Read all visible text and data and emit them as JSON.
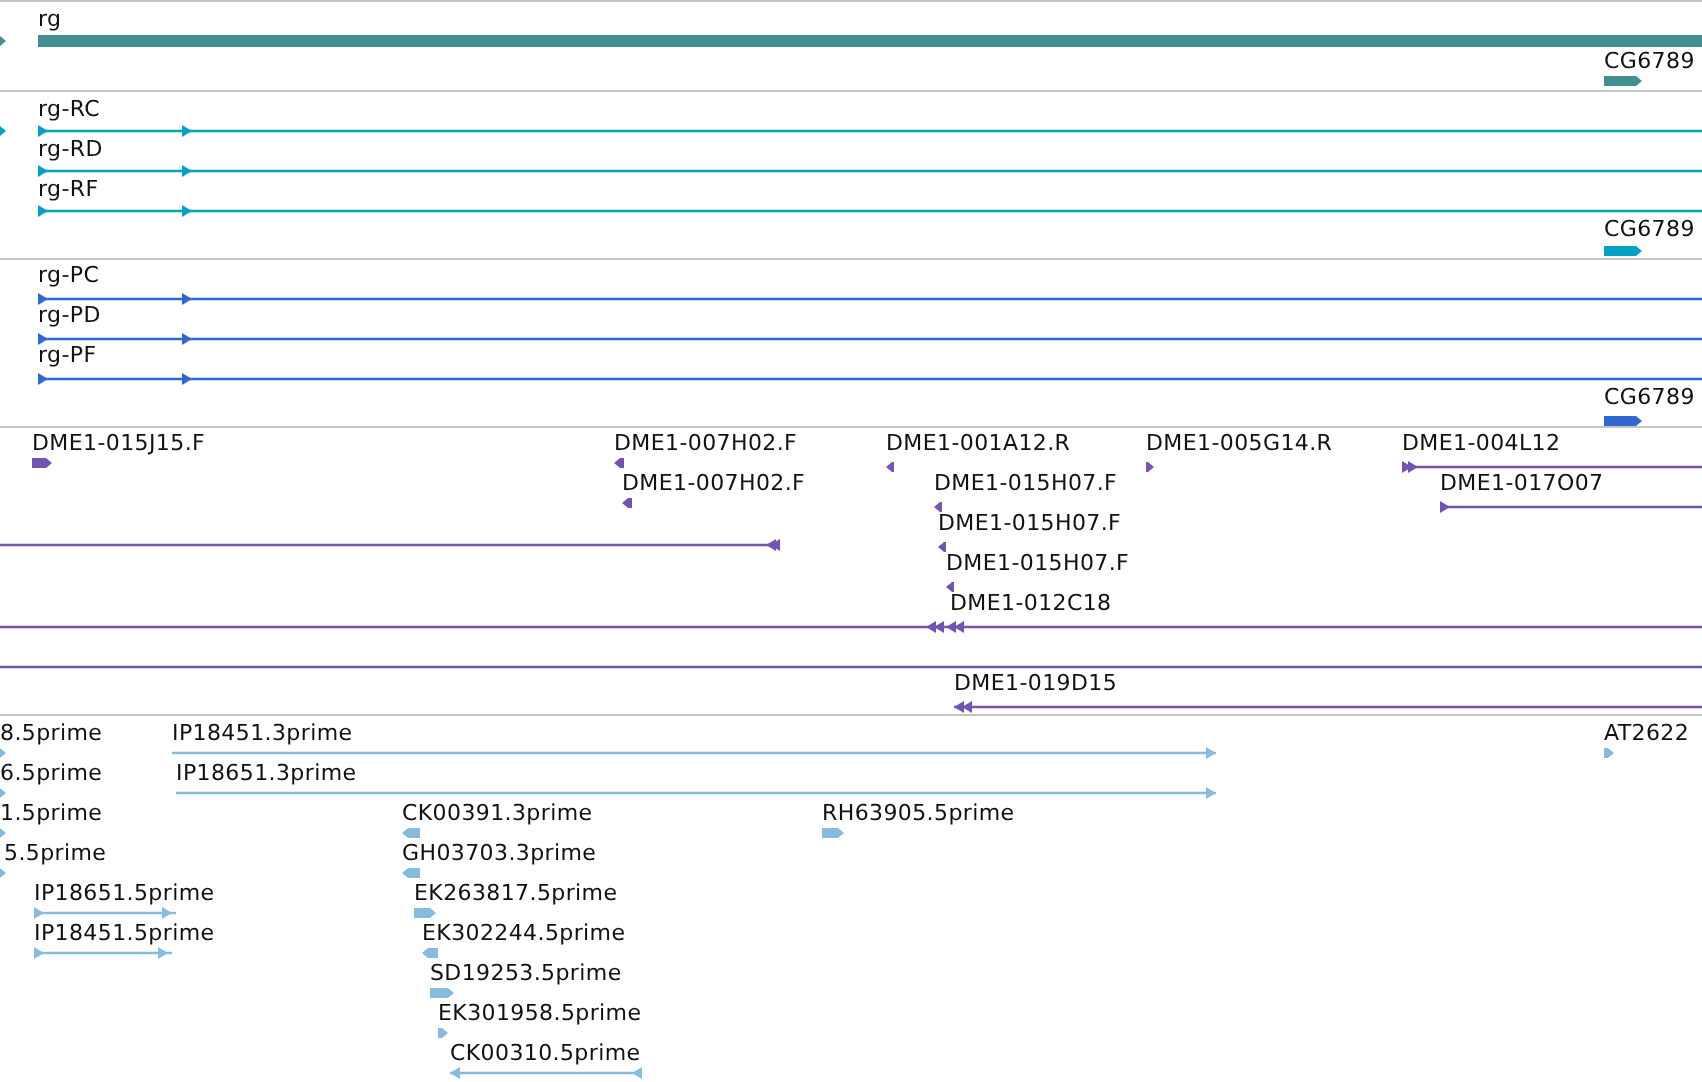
{
  "tracks": [
    {
      "color": "#418f91",
      "features": [
        {
          "kind": "block",
          "reverse": false
        },
        {
          "label": "rg",
          "kind": "bar"
        },
        {
          "label": "CG6789",
          "kind": "block",
          "reverse": false
        }
      ]
    },
    {
      "color": "#05a0c5",
      "features": [
        {
          "kind": "block",
          "reverse": false
        },
        {
          "label": "rg-RC",
          "kind": "line",
          "reverse": false
        },
        {
          "label": "rg-RD",
          "kind": "line",
          "reverse": false
        },
        {
          "label": "rg-RF",
          "kind": "line",
          "reverse": false
        },
        {
          "label": "CG6789",
          "kind": "block",
          "reverse": false
        }
      ]
    },
    {
      "color": "#3067d0",
      "features": [
        {
          "label": "rg-PC",
          "kind": "line",
          "reverse": false
        },
        {
          "label": "rg-PD",
          "kind": "line",
          "reverse": false
        },
        {
          "label": "rg-PF",
          "kind": "line",
          "reverse": false
        },
        {
          "label": "CG6789",
          "kind": "block",
          "reverse": false
        }
      ]
    },
    {
      "color": "#7355b1",
      "features": [
        {
          "label": "DME1-015J15.F",
          "kind": "block",
          "reverse": false
        },
        {
          "label": "DME1-007H02.F",
          "kind": "block",
          "reverse": true
        },
        {
          "label": "DME1-001A12.R",
          "kind": "block",
          "reverse": true
        },
        {
          "label": "DME1-005G14.R",
          "kind": "block",
          "reverse": false
        },
        {
          "label": "DME1-004L12",
          "kind": "line",
          "reverse": false
        },
        {
          "label": "DME1-007H02.F",
          "kind": "block",
          "reverse": true
        },
        {
          "label": "DME1-015H07.F",
          "kind": "block",
          "reverse": true
        },
        {
          "label": "DME1-017O07",
          "kind": "line",
          "reverse": false
        },
        {
          "label": "DME1-015H07.F",
          "kind": "block",
          "reverse": true
        },
        {
          "label": "DME1-015H07.F",
          "kind": "block",
          "reverse": true
        },
        {
          "kind": "line",
          "reverse": true
        },
        {
          "label": "DME1-012C18",
          "kind": "line",
          "reverse": true
        },
        {
          "kind": "line"
        },
        {
          "label": "DME1-019D15",
          "kind": "line",
          "reverse": true
        }
      ]
    },
    {
      "color": "#88bbdd",
      "features": [
        {
          "label": "8.5prime",
          "kind": "block",
          "reverse": false
        },
        {
          "label": "IP18451.3prime",
          "kind": "line",
          "reverse": false
        },
        {
          "label": "AT2622",
          "kind": "block",
          "reverse": false
        },
        {
          "label": "6.5prime",
          "kind": "block",
          "reverse": false
        },
        {
          "label": "IP18651.3prime",
          "kind": "line",
          "reverse": false
        },
        {
          "label": "1.5prime",
          "kind": "block",
          "reverse": false
        },
        {
          "label": "CK00391.3prime",
          "kind": "block",
          "reverse": true
        },
        {
          "label": "RH63905.5prime",
          "kind": "block",
          "reverse": false
        },
        {
          "label": "5.5prime",
          "kind": "block",
          "reverse": false
        },
        {
          "label": "GH03703.3prime",
          "kind": "block",
          "reverse": true
        },
        {
          "label": "IP18651.5prime",
          "kind": "line",
          "reverse": false
        },
        {
          "label": "EK263817.5prime",
          "kind": "block",
          "reverse": false
        },
        {
          "label": "IP18451.5prime",
          "kind": "line",
          "reverse": false
        },
        {
          "label": "EK302244.5prime",
          "kind": "block",
          "reverse": true
        },
        {
          "label": "SD19253.5prime",
          "kind": "block",
          "reverse": false
        },
        {
          "label": "EK301958.5prime",
          "kind": "block",
          "reverse": false
        },
        {
          "label": "CK00310.5prime",
          "kind": "line",
          "reverse": true
        }
      ]
    }
  ]
}
